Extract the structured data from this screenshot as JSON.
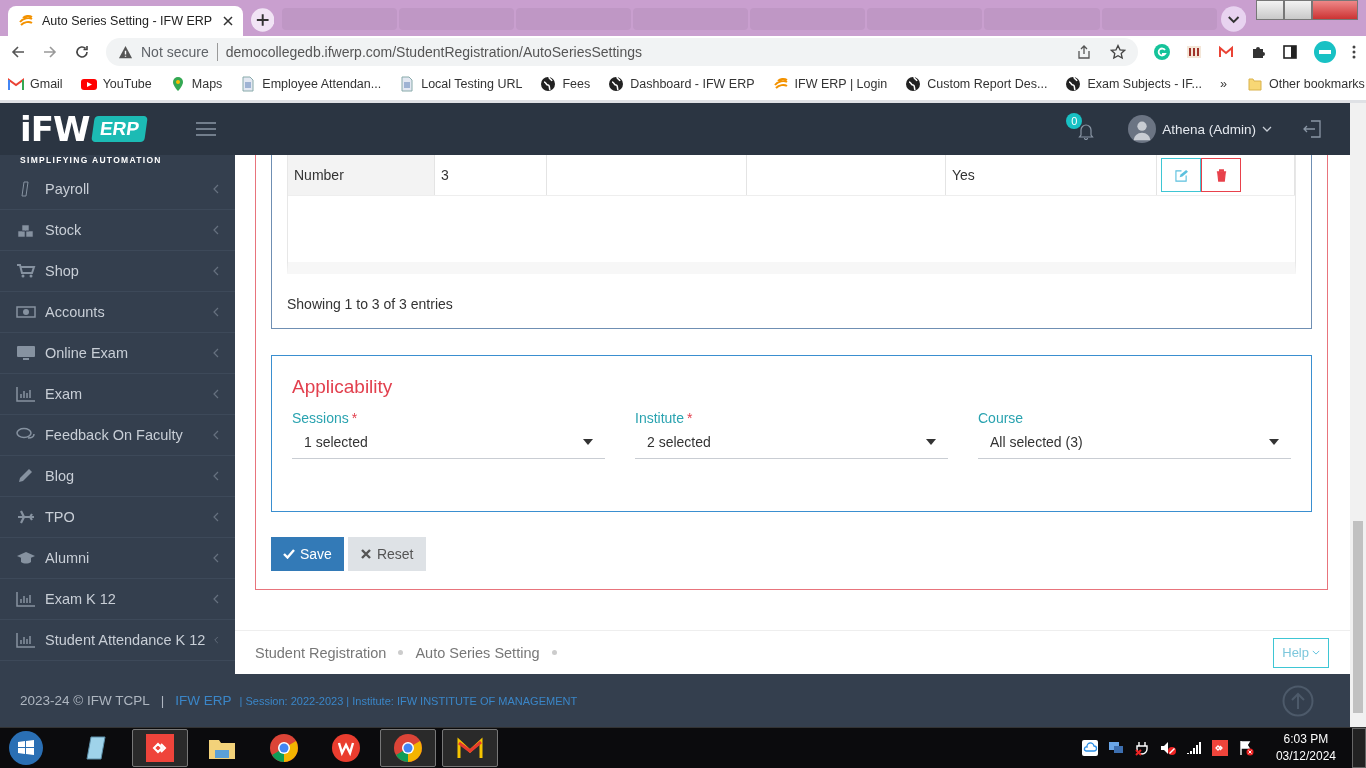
{
  "browser": {
    "active_tab": {
      "title": "Auto Series Setting - IFW ERP",
      "selected": true
    },
    "address": {
      "security": "Not secure",
      "url": "democollegedb.ifwerp.com/StudentRegistration/AutoSeriesSettings"
    },
    "bookmarks": [
      {
        "label": "Gmail",
        "kind": "gmail"
      },
      {
        "label": "YouTube",
        "kind": "youtube"
      },
      {
        "label": "Maps",
        "kind": "maps"
      },
      {
        "label": "Employee Attendan...",
        "kind": "doc"
      },
      {
        "label": "Local Testing URL",
        "kind": "doc"
      },
      {
        "label": "Fees",
        "kind": "globe"
      },
      {
        "label": "Dashboard - IFW ERP",
        "kind": "globe"
      },
      {
        "label": "IFW ERP | Login",
        "kind": "ifw"
      },
      {
        "label": "Custom Report Des...",
        "kind": "globe"
      },
      {
        "label": "Exam Subjects - IF...",
        "kind": "globe"
      }
    ],
    "overflow": "»",
    "other_bookmarks": "Other bookmarks"
  },
  "header": {
    "logo": {
      "word": "iFW",
      "badge": "ERP",
      "tagline": "SIMPLIFYING AUTOMATION"
    },
    "notification_count": "0",
    "user": "Athena (Admin)"
  },
  "sidebar": {
    "items": [
      {
        "label": "Payroll",
        "kind": "mobile"
      },
      {
        "label": "Stock",
        "kind": "cubes"
      },
      {
        "label": "Shop",
        "kind": "cart"
      },
      {
        "label": "Accounts",
        "kind": "money"
      },
      {
        "label": "Online Exam",
        "kind": "monitor"
      },
      {
        "label": "Exam",
        "kind": "chart"
      },
      {
        "label": "Feedback On Faculty",
        "kind": "comments"
      },
      {
        "label": "Blog",
        "kind": "pencil"
      },
      {
        "label": "TPO",
        "kind": "plane"
      },
      {
        "label": "Alumni",
        "kind": "cap"
      },
      {
        "label": "Exam K 12",
        "kind": "chart"
      },
      {
        "label": "Student Attendance K 12",
        "kind": "chart"
      }
    ]
  },
  "table": {
    "row": {
      "column_1": "Number",
      "column_2": "3",
      "column_5": "Yes"
    },
    "info": "Showing 1 to 3 of 3 entries"
  },
  "applicability": {
    "title": "Applicability",
    "fields": [
      {
        "label": "Sessions",
        "required_mark": "*",
        "value": "1 selected"
      },
      {
        "label": "Institute",
        "required_mark": "*",
        "value": "2 selected"
      },
      {
        "label": "Course",
        "value": "All selected (3)"
      }
    ]
  },
  "buttons": [
    {
      "label": "Save",
      "kind": "save"
    },
    {
      "label": "Reset",
      "kind": "reset"
    }
  ],
  "breadcrumb": [
    "Student Registration",
    "Auto Series Setting"
  ],
  "help": "Help",
  "footer": {
    "copyright": "2023-24 © IFW TCPL",
    "separator": "|",
    "brand": "IFW ERP",
    "meta": "| Session: 2022-2023 | Institute: IFW INSTITUTE OF MANAGEMENT"
  },
  "taskbar": {
    "apps": [
      {
        "kind": "notepad",
        "running": false
      },
      {
        "kind": "anydesk",
        "running": true
      },
      {
        "kind": "folder",
        "running": false
      },
      {
        "kind": "chrome",
        "running": false
      },
      {
        "kind": "wps",
        "running": false
      },
      {
        "kind": "chrome",
        "running": true
      },
      {
        "kind": "mail",
        "running": true
      }
    ],
    "time": "6:03 PM",
    "date": "03/12/2024"
  }
}
